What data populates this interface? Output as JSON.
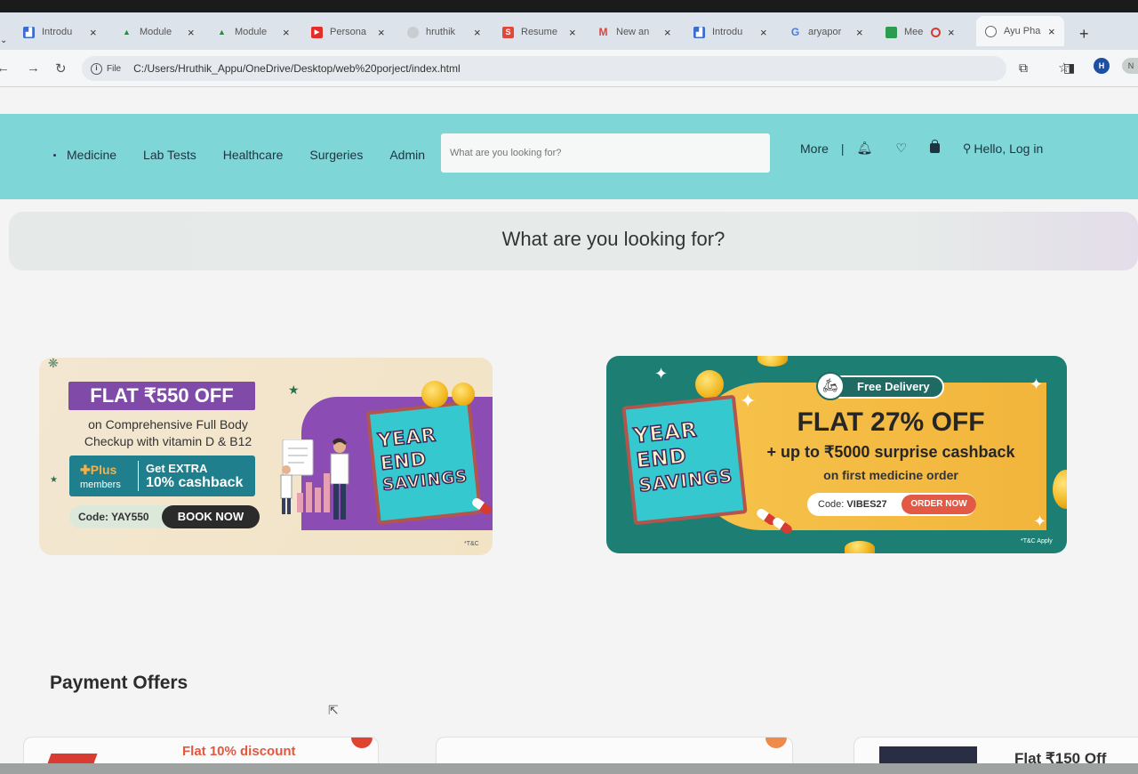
{
  "browser": {
    "tabs": [
      {
        "label": "Introdu",
        "favicon": "blue-square",
        "color": "#3b6ccf",
        "glyph": "▟"
      },
      {
        "label": "Module",
        "favicon": "drive",
        "color": "#2d8a44",
        "glyph": "▲"
      },
      {
        "label": "Module",
        "favicon": "drive",
        "color": "#2d8a44",
        "glyph": "▲"
      },
      {
        "label": "Persona",
        "favicon": "youtube",
        "color": "#e52d27",
        "glyph": "▶"
      },
      {
        "label": "hruthik",
        "favicon": "github",
        "color": "#bbbbbb",
        "glyph": "○"
      },
      {
        "label": "Resume",
        "favicon": "s-logo",
        "color": "#e0483a",
        "glyph": "S"
      },
      {
        "label": "New an",
        "favicon": "gmail",
        "color": "#d9453b",
        "glyph": "M"
      },
      {
        "label": "Introdu",
        "favicon": "blue-square",
        "color": "#3b6ccf",
        "glyph": "▟"
      },
      {
        "label": "aryapor",
        "favicon": "google",
        "color": "#4a7ae0",
        "glyph": "G"
      },
      {
        "label": "Mee",
        "favicon": "meet",
        "color": "#2d9c4f",
        "glyph": "▣"
      }
    ],
    "active_tab": {
      "label": "Ayu Pha"
    },
    "close_glyph": "×",
    "new_tab_glyph": "+",
    "file_label": "File",
    "url": "C:/Users/Hruthik_Appu/OneDrive/Desktop/web%20porject/index.html",
    "profile_initial": "H",
    "profile2_initial": "N"
  },
  "site": {
    "nav_links": [
      "Medicine",
      "Lab Tests",
      "Healthcare",
      "Surgeries",
      "Admin"
    ],
    "search_placeholder": "What are you looking for?",
    "more": "More",
    "separator": "|",
    "login": "Hello, Log in",
    "looking_title": "What are you looking for?"
  },
  "banner1": {
    "headline": "FLAT ₹550 OFF",
    "desc_line1": "on Comprehensive Full Body",
    "desc_line2": "Checkup with vitamin D & B12",
    "plus": "✚Plus",
    "members": "members",
    "get_extra": "Get EXTRA",
    "cashback": "10% cashback",
    "code": "Code: YAY550",
    "cta": "BOOK NOW",
    "calendar_lines": [
      "YEAR",
      "END",
      "SAVINGS"
    ],
    "tnc": "*T&C"
  },
  "banner2": {
    "free_delivery": "Free Delivery",
    "headline": "FLAT 27% OFF",
    "cashback": "+ up to ₹5000 surprise cashback",
    "first_order": "on first medicine order",
    "code_prefix": "Code:",
    "code": "VIBES27",
    "cta": "ORDER NOW",
    "calendar_lines": [
      "YEAR",
      "END",
      "SAVINGS"
    ],
    "tnc": "*T&C Apply"
  },
  "payment": {
    "heading": "Payment Offers",
    "card1": "Flat 10% discount",
    "card3": "Flat ₹150 Off"
  },
  "colors": {
    "nav_bg": "#7fd6d6",
    "purple": "#7f4aa8",
    "teal": "#1d7f74",
    "gold": "#f4bd47",
    "cta_red": "#e25a45"
  }
}
